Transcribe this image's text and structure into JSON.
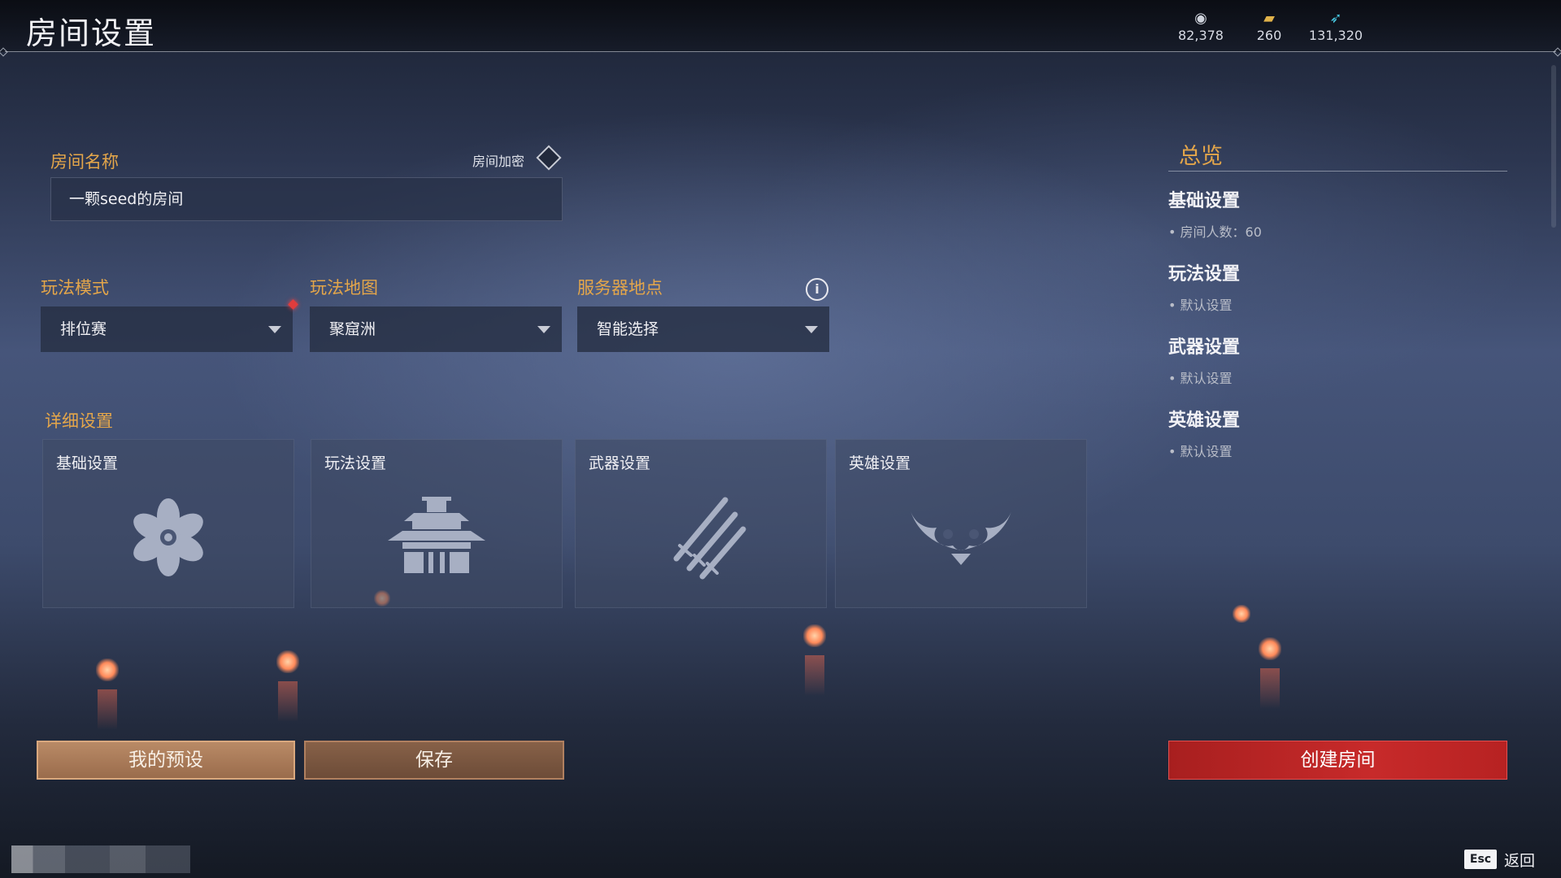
{
  "header": {
    "title": "房间设置",
    "currencies": [
      {
        "icon": "silver-coin-icon",
        "value": "82,378"
      },
      {
        "icon": "gold-ingot-icon",
        "value": "260"
      },
      {
        "icon": "feather-icon",
        "value": "131,320"
      }
    ]
  },
  "room": {
    "name_label": "房间名称",
    "name_value": "一颗seed的房间",
    "encrypt_label": "房间加密"
  },
  "selects": {
    "mode": {
      "label": "玩法模式",
      "value": "排位赛"
    },
    "map": {
      "label": "玩法地图",
      "value": "聚窟洲"
    },
    "server": {
      "label": "服务器地点",
      "value": "智能选择"
    }
  },
  "details": {
    "label": "详细设置",
    "cards": [
      {
        "title": "基础设置",
        "icon": "flower-gear-icon"
      },
      {
        "title": "玩法设置",
        "icon": "pagoda-icon"
      },
      {
        "title": "武器设置",
        "icon": "swords-icon"
      },
      {
        "title": "英雄设置",
        "icon": "demon-mask-icon"
      }
    ]
  },
  "buttons": {
    "preset": "我的预设",
    "save": "保存",
    "create": "创建房间"
  },
  "summary": {
    "title": "总览",
    "sections": [
      {
        "title": "基础设置",
        "value": "• 房间人数：60"
      },
      {
        "title": "玩法设置",
        "value": "• 默认设置"
      },
      {
        "title": "武器设置",
        "value": "• 默认设置"
      },
      {
        "title": "英雄设置",
        "value": "• 默认设置"
      }
    ]
  },
  "footer": {
    "esc_key": "Esc",
    "back_label": "返回"
  },
  "colors": {
    "accent_orange": "#e4a64a",
    "create_red": "#c72a2a",
    "preset_button": "#b98a66"
  }
}
